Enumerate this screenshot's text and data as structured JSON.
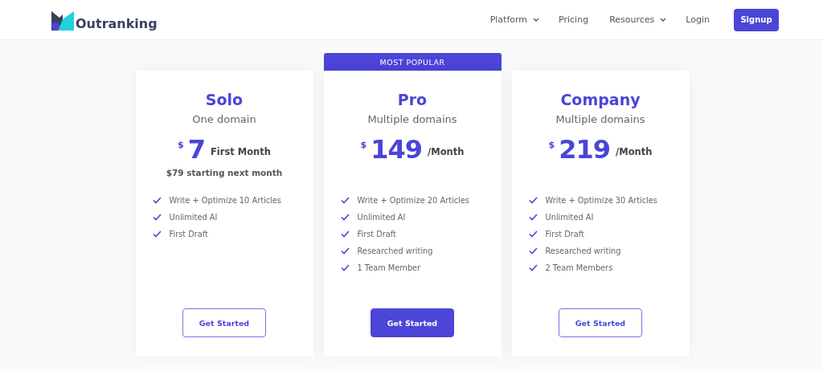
{
  "header": {
    "brand": "Outranking",
    "nav": [
      {
        "label": "Platform",
        "dropdown": true
      },
      {
        "label": "Pricing",
        "dropdown": false
      },
      {
        "label": "Resources",
        "dropdown": true
      },
      {
        "label": "Login",
        "dropdown": false
      }
    ],
    "cta": "Signup"
  },
  "plans": [
    {
      "name": "Solo",
      "subtitle": "One domain",
      "currency": "$",
      "amount": "7",
      "period": "First Month",
      "note": "$79 starting next month",
      "features": [
        "Write + Optimize 10 Articles",
        "Unlimited AI",
        "First Draft"
      ],
      "button": "Get Started",
      "featured": false
    },
    {
      "badge": "MOST POPULAR",
      "name": "Pro",
      "subtitle": "Multiple domains",
      "currency": "$",
      "amount": "149",
      "period": "/Month",
      "features": [
        "Write + Optimize 20 Articles",
        "Unlimited AI",
        "First Draft",
        "Researched writing",
        "1 Team Member"
      ],
      "button": "Get Started",
      "featured": true
    },
    {
      "name": "Company",
      "subtitle": "Multiple domains",
      "currency": "$",
      "amount": "219",
      "period": "/Month",
      "features": [
        "Write + Optimize 30 Articles",
        "Unlimited AI",
        "First Draft",
        "Researched writing",
        "2 Team Members"
      ],
      "button": "Get Started",
      "featured": false
    }
  ]
}
